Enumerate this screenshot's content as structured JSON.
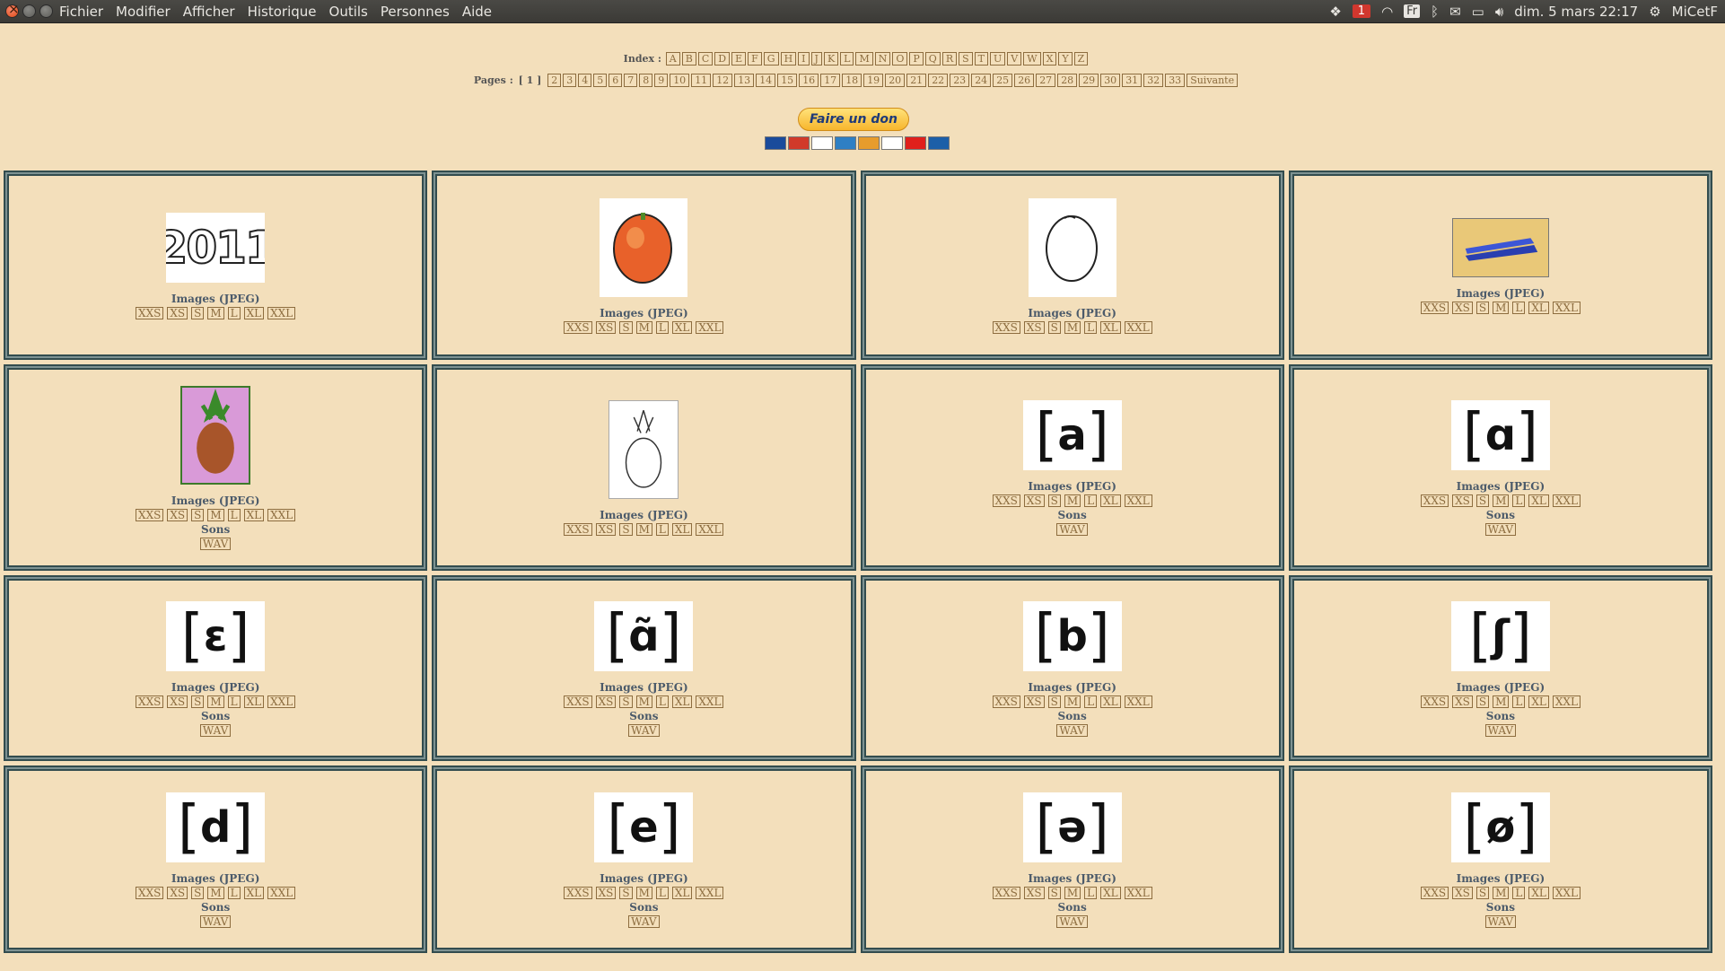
{
  "menubar": {
    "items": [
      "Fichier",
      "Modifier",
      "Afficher",
      "Historique",
      "Outils",
      "Personnes",
      "Aide"
    ],
    "tray": {
      "badge": "1",
      "lang": "Fr",
      "datetime": "dim. 5 mars 22:17",
      "user": "MiCetF"
    }
  },
  "index": {
    "label": "Index :",
    "letters": [
      "A",
      "B",
      "C",
      "D",
      "E",
      "F",
      "G",
      "H",
      "I",
      "J",
      "K",
      "L",
      "M",
      "N",
      "O",
      "P",
      "Q",
      "R",
      "S",
      "T",
      "U",
      "V",
      "W",
      "X",
      "Y",
      "Z"
    ]
  },
  "pages": {
    "label": "Pages :",
    "current": "[ 1 ]",
    "numbers": [
      "2",
      "3",
      "4",
      "5",
      "6",
      "7",
      "8",
      "9",
      "10",
      "11",
      "12",
      "13",
      "14",
      "15",
      "16",
      "17",
      "18",
      "19",
      "20",
      "21",
      "22",
      "23",
      "24",
      "25",
      "26",
      "27",
      "28",
      "29",
      "30",
      "31",
      "32",
      "33"
    ],
    "next": "Suivante"
  },
  "donate": {
    "label": "Faire un don"
  },
  "labels": {
    "images": "Images (JPEG)",
    "sounds": "Sons"
  },
  "sizes": [
    "XXS",
    "XS",
    "S",
    "M",
    "L",
    "XL",
    "XXL"
  ],
  "sound_formats": [
    "WAV"
  ],
  "items": [
    {
      "kind": "image",
      "picture": "year-2011",
      "text": "2011",
      "sounds": false
    },
    {
      "kind": "image",
      "picture": "apricot-color",
      "sounds": false
    },
    {
      "kind": "image",
      "picture": "apricot-outline",
      "sounds": false
    },
    {
      "kind": "image",
      "picture": "stapler",
      "sounds": false
    },
    {
      "kind": "image",
      "picture": "pineapple-color",
      "sounds": true
    },
    {
      "kind": "image",
      "picture": "pineapple-outline",
      "sounds": false
    },
    {
      "kind": "phoneme",
      "symbol": "a",
      "sounds": true
    },
    {
      "kind": "phoneme",
      "symbol": "ɑ",
      "sounds": true
    },
    {
      "kind": "phoneme",
      "symbol": "ɛ",
      "sounds": true
    },
    {
      "kind": "phoneme",
      "symbol": "ɑ̃",
      "sounds": true
    },
    {
      "kind": "phoneme",
      "symbol": "b",
      "sounds": true
    },
    {
      "kind": "phoneme",
      "symbol": "ʃ",
      "sounds": true
    },
    {
      "kind": "phoneme",
      "symbol": "d",
      "sounds": true
    },
    {
      "kind": "phoneme",
      "symbol": "e",
      "sounds": true
    },
    {
      "kind": "phoneme",
      "symbol": "ə",
      "sounds": true
    },
    {
      "kind": "phoneme",
      "symbol": "ø",
      "sounds": true
    }
  ]
}
